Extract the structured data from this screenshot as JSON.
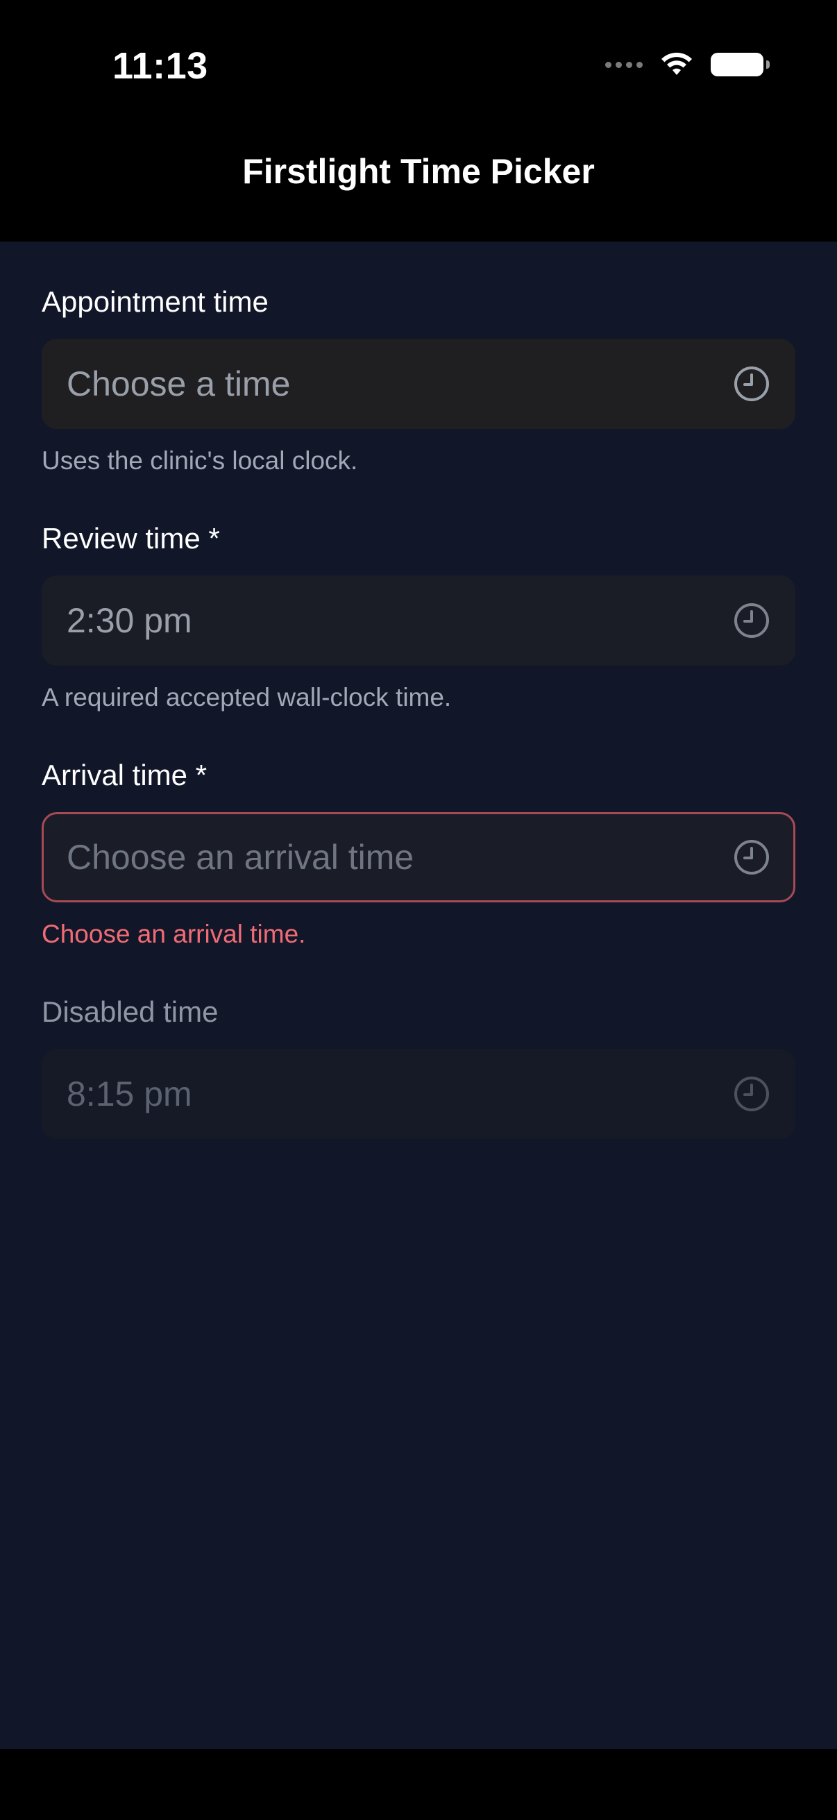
{
  "status_bar": {
    "time": "11:13"
  },
  "header": {
    "title": "Firstlight Time Picker"
  },
  "fields": [
    {
      "label": "Appointment time",
      "value": "Choose a time",
      "helper": "Uses the clinic's local clock.",
      "state": "empty"
    },
    {
      "label": "Review time *",
      "value": "2:30 pm",
      "helper": "A required accepted wall-clock time.",
      "state": "filled"
    },
    {
      "label": "Arrival time *",
      "value": "Choose an arrival time",
      "helper": "Choose an arrival time.",
      "state": "error"
    },
    {
      "label": "Disabled time",
      "value": "8:15 pm",
      "state": "disabled"
    }
  ],
  "icons": {
    "field_icon": "clock-icon"
  },
  "colors": {
    "background": "#111729",
    "error": "#f06b74",
    "error_border": "#a74a56"
  }
}
